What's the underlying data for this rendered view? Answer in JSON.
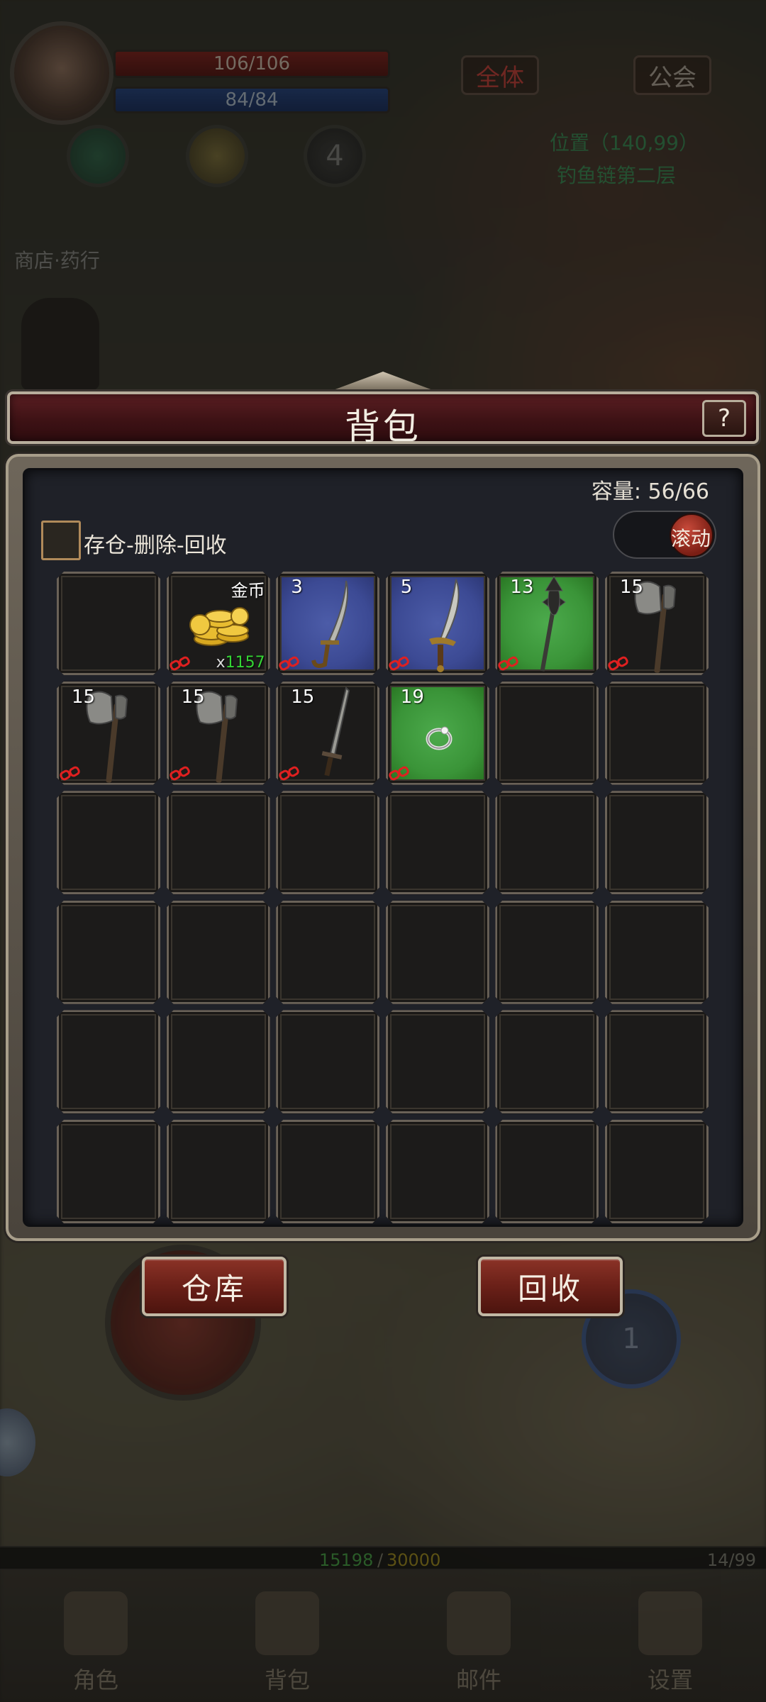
{
  "hud": {
    "hp": "106/106",
    "mp": "84/84",
    "btn_all": "全体",
    "btn_guild": "公会",
    "skill3_count": "4",
    "position": "位置（140,99）",
    "map": "钓鱼链第二层",
    "npc_name": "商店·药行"
  },
  "bag": {
    "title": "背包",
    "help": "?",
    "capacity_label": "容量: 56/66",
    "checkbox_label": "存仓-删除-回收",
    "scroll_label": "滚动",
    "slots": [
      {
        "type": "empty"
      },
      {
        "type": "gold",
        "name": "金币",
        "count_prefix": "x",
        "count": "1157",
        "bound": true
      },
      {
        "type": "saber",
        "level": "3",
        "quality": "blue",
        "bound": true
      },
      {
        "type": "dagger",
        "level": "5",
        "quality": "blue",
        "bound": true
      },
      {
        "type": "mace",
        "level": "13",
        "quality": "green",
        "bound": true
      },
      {
        "type": "axe",
        "level": "15",
        "quality": "none",
        "bound": true
      },
      {
        "type": "axe",
        "level": "15",
        "quality": "none",
        "bound": true
      },
      {
        "type": "axe",
        "level": "15",
        "quality": "none",
        "bound": true
      },
      {
        "type": "sword",
        "level": "15",
        "quality": "none",
        "bound": true
      },
      {
        "type": "ring",
        "level": "19",
        "quality": "green",
        "bound": true
      },
      {
        "type": "empty"
      },
      {
        "type": "empty"
      },
      {
        "type": "empty"
      },
      {
        "type": "empty"
      },
      {
        "type": "empty"
      },
      {
        "type": "empty"
      },
      {
        "type": "empty"
      },
      {
        "type": "empty"
      },
      {
        "type": "empty"
      },
      {
        "type": "empty"
      },
      {
        "type": "empty"
      },
      {
        "type": "empty"
      },
      {
        "type": "empty"
      },
      {
        "type": "empty"
      },
      {
        "type": "empty"
      },
      {
        "type": "empty"
      },
      {
        "type": "empty"
      },
      {
        "type": "empty"
      },
      {
        "type": "empty"
      },
      {
        "type": "empty"
      },
      {
        "type": "empty"
      },
      {
        "type": "empty"
      },
      {
        "type": "empty"
      },
      {
        "type": "empty"
      },
      {
        "type": "empty"
      },
      {
        "type": "empty"
      }
    ],
    "warehouse_button": "仓库",
    "recycle_button": "回收"
  },
  "bottom": {
    "circle_count": "1",
    "exp_current": "15198",
    "exp_sep": "/",
    "exp_max": "30000",
    "exp_right": "14/99",
    "nav": [
      "角色",
      "背包",
      "邮件",
      "设置"
    ]
  },
  "colors": {
    "quality_blue": "#3c4a94",
    "quality_green": "#3a9438",
    "title_red": "#4e161a",
    "count_green": "#34d434"
  }
}
